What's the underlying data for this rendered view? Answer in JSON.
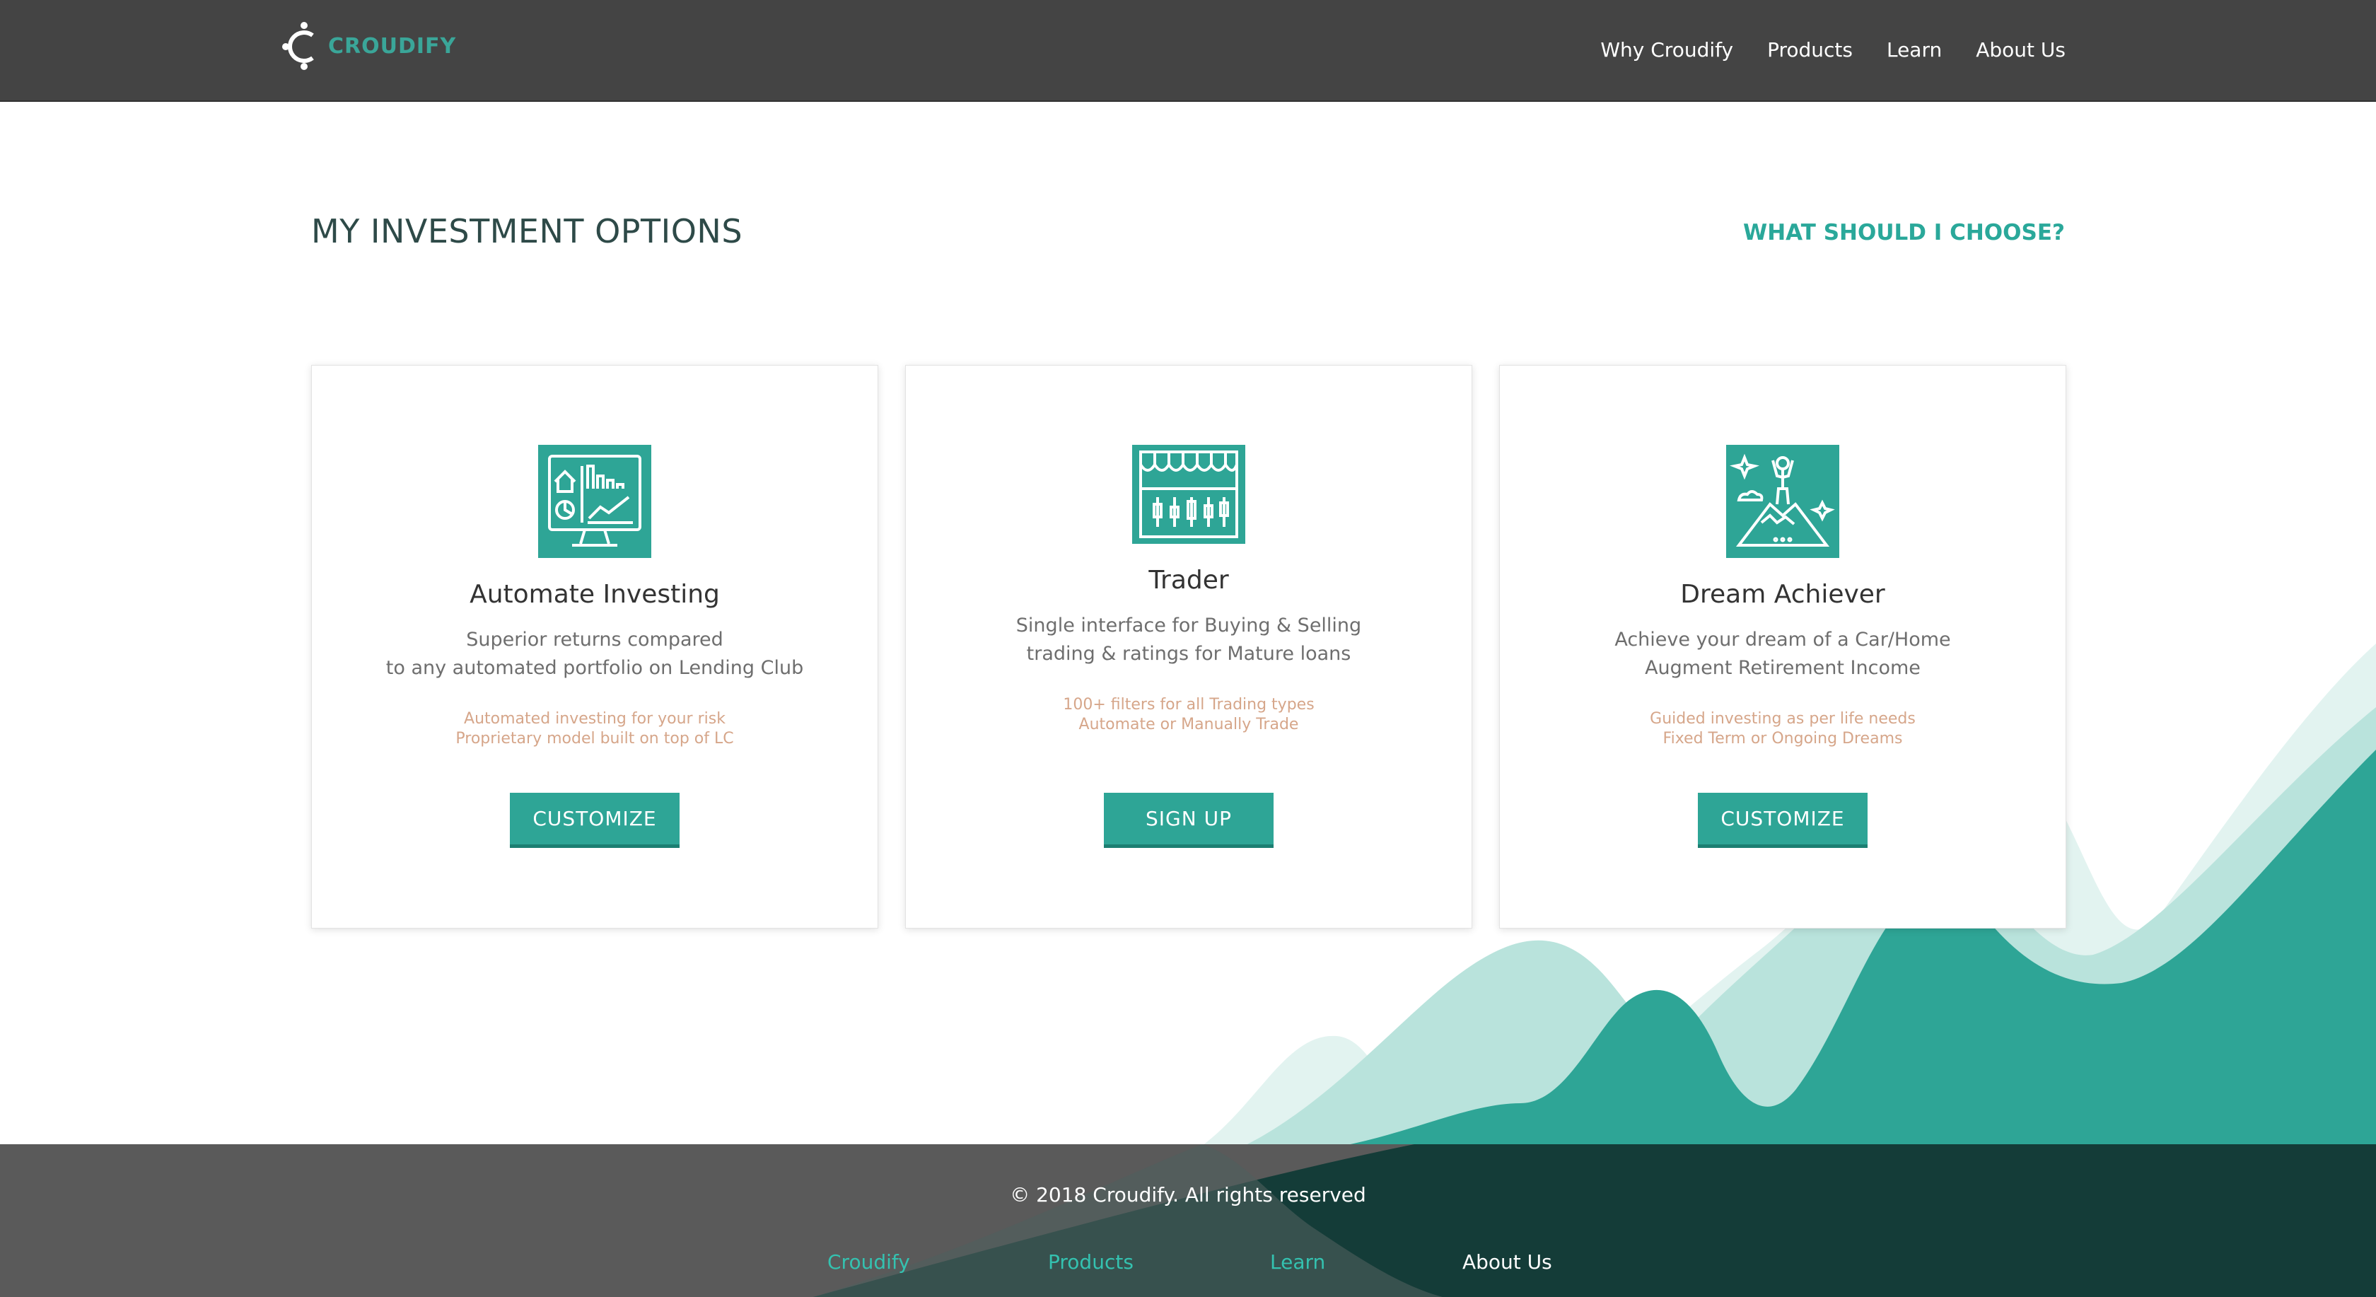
{
  "header": {
    "brand": "CROUDIFY",
    "nav": [
      "Why Croudify",
      "Products",
      "Learn",
      "About Us"
    ]
  },
  "main": {
    "title": "MY INVESTMENT OPTIONS",
    "choose_link": "WHAT SHOULD I CHOOSE?"
  },
  "cards": [
    {
      "title": "Automate Investing",
      "desc": [
        "Superior returns compared",
        "to any automated portfolio on Lending Club"
      ],
      "notes": [
        "Automated investing for your risk",
        "Proprietary model built on top of LC"
      ],
      "button": "CUSTOMIZE",
      "icon": "dashboard-monitor-icon"
    },
    {
      "title": "Trader",
      "desc": [
        "Single interface for Buying & Selling",
        "trading & ratings for Mature loans"
      ],
      "notes": [
        "100+ filters for all Trading types",
        "Automate or Manually Trade"
      ],
      "button": "SIGN UP",
      "icon": "market-stall-icon"
    },
    {
      "title": "Dream Achiever",
      "desc": [
        "Achieve your dream of a Car/Home",
        "Augment Retirement Income"
      ],
      "notes": [
        "Guided investing as per life needs",
        "Fixed Term or Ongoing Dreams"
      ],
      "button": "CUSTOMIZE",
      "icon": "mountain-summit-icon"
    }
  ],
  "footer": {
    "copyright": "© 2018 Croudify. All rights reserved",
    "links": [
      "Croudify",
      "Products",
      "Learn",
      "About Us"
    ]
  },
  "colors": {
    "header_bg": "#444444",
    "accent": "#2ea596",
    "title": "#2e4a48",
    "note": "#d6a68a",
    "footer_bg": "#5a5a5a",
    "footer_dark": "#143c38"
  }
}
